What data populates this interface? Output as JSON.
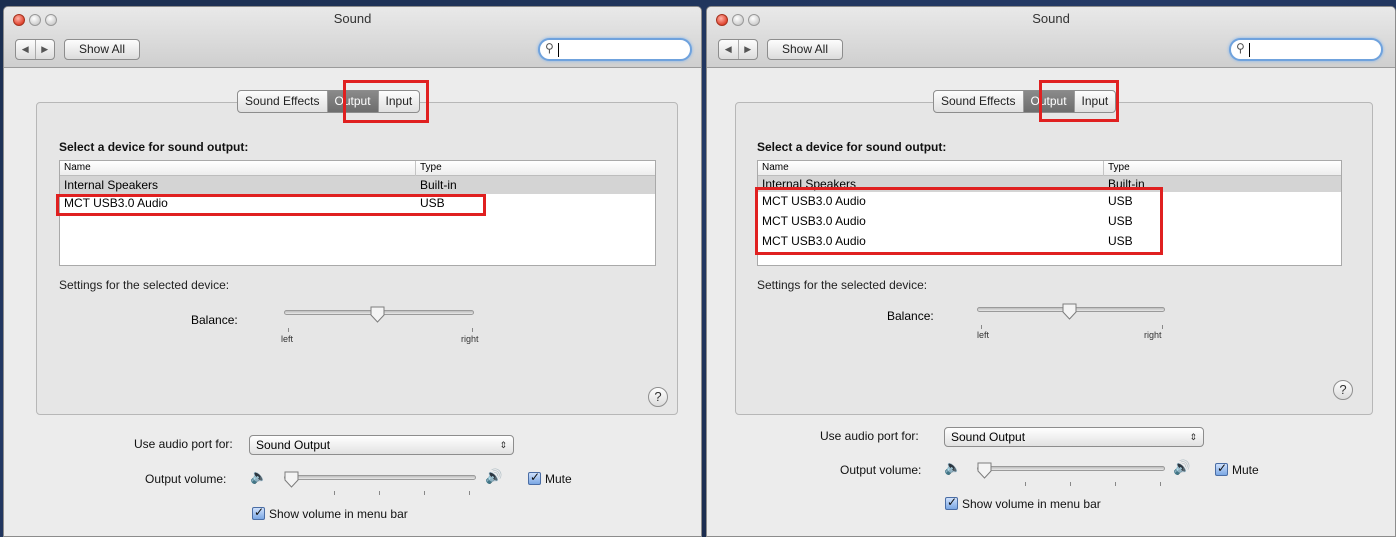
{
  "windows": [
    {
      "title": "Sound",
      "toolbar": {
        "back": "◀",
        "forward": "▶",
        "show_all": "Show All",
        "search_placeholder": ""
      },
      "tabs": [
        "Sound Effects",
        "Output",
        "Input"
      ],
      "heading": "Select a device for sound output:",
      "columns": [
        "Name",
        "Type"
      ],
      "rows": [
        {
          "name": "Internal Speakers",
          "type": "Built-in"
        },
        {
          "name": "MCT USB3.0 Audio",
          "type": "USB"
        }
      ],
      "settings_label": "Settings for the selected device:",
      "balance_label": "Balance:",
      "balance_left": "left",
      "balance_right": "right",
      "balance_value": 0.5,
      "help": "?",
      "audio_port_label": "Use audio port for:",
      "audio_port_value": "Sound Output",
      "output_volume_label": "Output volume:",
      "volume_value": 0.0,
      "mute_label": "Mute",
      "mute_checked": true,
      "show_volume_label": "Show volume in menu bar",
      "show_volume_checked": true
    },
    {
      "title": "Sound",
      "toolbar": {
        "back": "◀",
        "forward": "▶",
        "show_all": "Show All",
        "search_placeholder": ""
      },
      "tabs": [
        "Sound Effects",
        "Output",
        "Input"
      ],
      "heading": "Select a device for sound output:",
      "columns": [
        "Name",
        "Type"
      ],
      "rows": [
        {
          "name": "Internal Speakers",
          "type": "Built-in"
        },
        {
          "name": "MCT USB3.0 Audio",
          "type": "USB"
        },
        {
          "name": "MCT USB3.0 Audio",
          "type": "USB"
        },
        {
          "name": "MCT USB3.0 Audio",
          "type": "USB"
        }
      ],
      "settings_label": "Settings for the selected device:",
      "balance_label": "Balance:",
      "balance_left": "left",
      "balance_right": "right",
      "balance_value": 0.5,
      "help": "?",
      "audio_port_label": "Use audio port for:",
      "audio_port_value": "Sound Output",
      "output_volume_label": "Output volume:",
      "volume_value": 0.0,
      "mute_label": "Mute",
      "mute_checked": true,
      "show_volume_label": "Show volume in menu bar",
      "show_volume_checked": true
    }
  ],
  "colors": {
    "highlight": "#e02020",
    "selected_row": "#d4d4d4",
    "active_tab": "#7a7a7a"
  }
}
